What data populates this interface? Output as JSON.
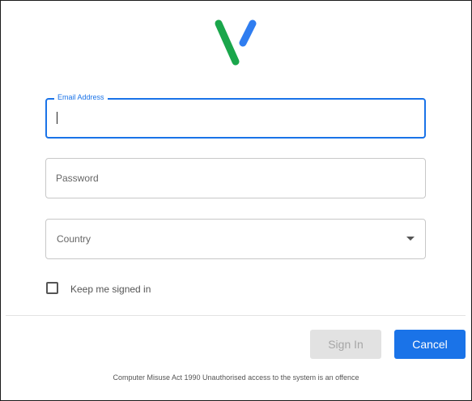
{
  "brand": {
    "logo_icon": "v-logo-icon",
    "colors": {
      "green": "#1aa64b",
      "blue": "#2f7df0"
    }
  },
  "form": {
    "email": {
      "label": "Email Address",
      "value": "",
      "focused": true
    },
    "password": {
      "placeholder": "Password",
      "value": ""
    },
    "country": {
      "placeholder": "Country",
      "selected": ""
    },
    "remember": {
      "label": "Keep me signed in",
      "checked": false
    }
  },
  "actions": {
    "signin_label": "Sign In",
    "signin_enabled": false,
    "cancel_label": "Cancel"
  },
  "footer_text": "Computer Misuse Act 1990 Unauthorised access to the system is an offence",
  "colors": {
    "accent": "#1a73e8",
    "disabled_bg": "#e2e2e2",
    "disabled_text": "#a6a6a6"
  }
}
